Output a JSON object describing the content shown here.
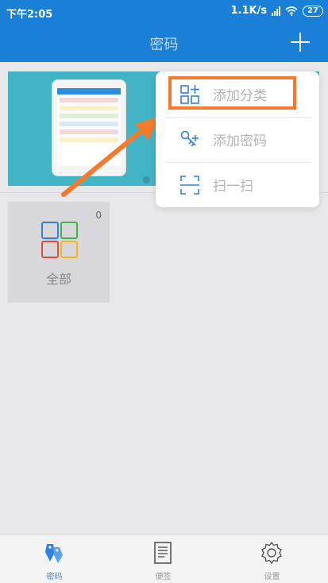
{
  "status": {
    "time": "下午2:05",
    "net_speed": "1.1K/s",
    "battery": "27"
  },
  "appbar": {
    "title": "密码",
    "add_icon": "plus-icon"
  },
  "banner": {
    "carousel_dots": 1
  },
  "menu": {
    "items": [
      {
        "label": "添加分类",
        "icon": "add-category-icon"
      },
      {
        "label": "添加密码",
        "icon": "key-plus-icon"
      },
      {
        "label": "扫一扫",
        "icon": "scan-icon"
      }
    ]
  },
  "category": {
    "label": "全部",
    "count": "0",
    "colors": [
      "#2f80e1",
      "#3fb24a",
      "#e04a3f",
      "#f2b51b"
    ]
  },
  "tabs": [
    {
      "label": "密码",
      "icon": "keys-icon",
      "active": true
    },
    {
      "label": "便签",
      "icon": "note-icon",
      "active": false
    },
    {
      "label": "设置",
      "icon": "gear-icon",
      "active": false
    }
  ],
  "accent": "#1a7fd6",
  "highlight_color": "#f57a2c"
}
